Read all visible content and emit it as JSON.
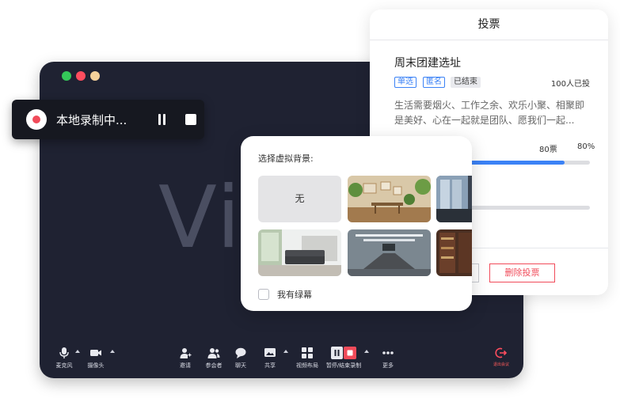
{
  "meeting": {
    "background_word": "Vi",
    "toolbar": {
      "mic_label": "麦克风",
      "camera_label": "摄像头",
      "invite_label": "邀请",
      "participants_label": "参会者",
      "chat_label": "聊天",
      "share_label": "共享",
      "layout_label": "视频布局",
      "record_label": "暂停/结束录制",
      "more_label": "更多",
      "leave_label": "退出会议"
    }
  },
  "recording": {
    "status_text": "本地录制中..."
  },
  "poll": {
    "header": "投票",
    "title": "周末团建选址",
    "tags": [
      "单选",
      "匿名",
      "已结束"
    ],
    "voted_count": "100人已投",
    "description": "生活需要烟火、工作之余、欢乐小聚、相聚即是美好、心在一起就是团队、愿我们一起...",
    "options": [
      {
        "votes": "80票",
        "percent": "80%",
        "fraction": 0.8
      },
      {
        "fraction": 0.0
      }
    ],
    "delete_button": "删除投票"
  },
  "background_picker": {
    "title": "选择虚拟背景:",
    "none_label": "无",
    "thumbnails": [
      "none",
      "green-room",
      "office-dark",
      "living-room",
      "conference-room",
      "library"
    ],
    "green_screen_label": "我有绿幕",
    "green_screen_checked": false
  },
  "colors": {
    "window_bg": "#1f2232",
    "accent_blue": "#3b82f6",
    "danger_red": "#f14b5a"
  }
}
